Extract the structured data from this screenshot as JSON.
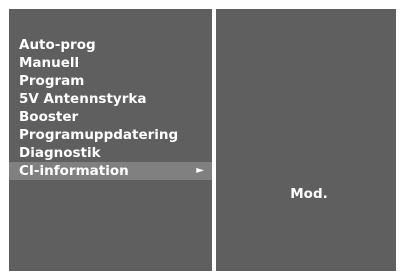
{
  "menu": {
    "items": [
      {
        "label": "Auto-prog"
      },
      {
        "label": "Manuell"
      },
      {
        "label": "Program"
      },
      {
        "label": "5V Antennstyrka"
      },
      {
        "label": "Booster"
      },
      {
        "label": "Programuppdatering"
      },
      {
        "label": "Diagnostik"
      },
      {
        "label": "CI-information",
        "arrow": "►",
        "selected": true
      }
    ]
  },
  "submenu": {
    "label": "Mod."
  },
  "colors": {
    "panel": "#5f5f5f",
    "highlight": "#808080",
    "text": "#ffffff",
    "background": "#ffffff"
  },
  "icons": {
    "submenu_arrow": "right-triangle-icon"
  }
}
